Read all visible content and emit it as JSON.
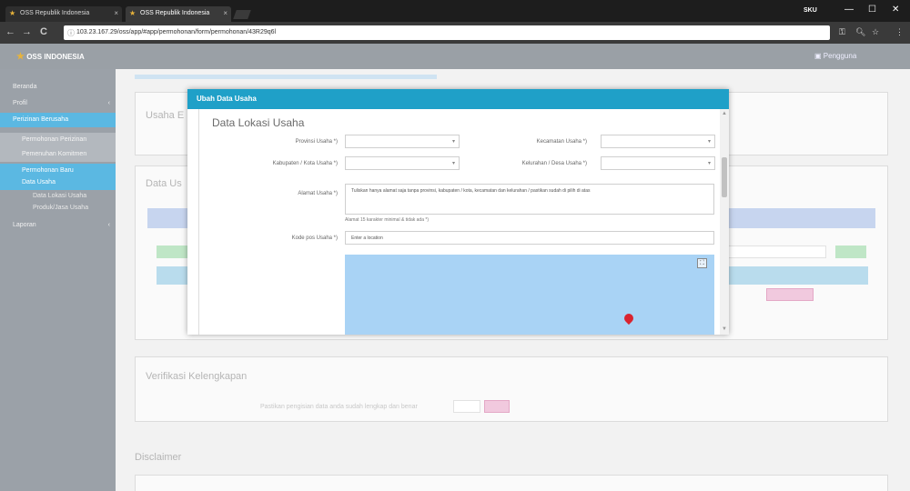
{
  "browser": {
    "tabs": [
      {
        "title": "OSS Republik Indonesia",
        "active": false
      },
      {
        "title": "OSS Republik Indonesia",
        "active": true
      }
    ],
    "profile": "SKU",
    "url": "103.23.167.29/oss/app/#app/permohonan/form/permohonan/43R29q6l",
    "nav": {
      "back": "←",
      "forward": "→",
      "reload": "C"
    },
    "window_controls": {
      "minimize": "—",
      "maximize": "☐",
      "close": "✕"
    }
  },
  "app": {
    "logo_text": "OSS INDONESIA",
    "user_label": "Pengguna"
  },
  "sidebar": {
    "items": [
      {
        "label": "Beranda",
        "state": "normal"
      },
      {
        "label": "Profil",
        "state": "normal"
      },
      {
        "label": "Perizinan Berusaha",
        "state": "active"
      },
      {
        "label": "Permohonan Perizinan",
        "state": "sub"
      },
      {
        "label": "Pemenuhan Komitmen",
        "state": "sub"
      },
      {
        "label": "Permohonan Baru",
        "state": "subactive"
      },
      {
        "label": "Data Usaha",
        "state": "subactive"
      },
      {
        "label": "Data Lokasi Usaha",
        "state": "sub2"
      },
      {
        "label": "Produk/Jasa Usaha",
        "state": "sub2"
      },
      {
        "label": "Laporan",
        "state": "normal"
      }
    ]
  },
  "background": {
    "panel1_title": "Usaha E",
    "panel2_title": "Data Us",
    "panel3_title": "Verifikasi Kelengkapan",
    "panel3_text": "Pastikan pengisian data anda sudah lengkap dan benar",
    "panel4_title": "Disclaimer"
  },
  "modal": {
    "title": "Ubah Data Usaha",
    "section_title": "Data Lokasi Usaha",
    "fields": {
      "provinsi_label": "Provinsi Usaha *)",
      "kecamatan_label": "Kecamatan Usaha *)",
      "kabupaten_label": "Kabupaten / Kota Usaha *)",
      "kelurahan_label": "Kelurahan / Desa Usaha *)",
      "alamat_label": "Alamat Usaha *)",
      "alamat_value": "Tuliskan hanya alamat saja tanpa provinsi, kabupaten / kota, kecamatan dan kelurahan / pastikan sudah di pilih di atas",
      "alamat_hint": "Alamat 15 karakter minimal & tidak ada *)",
      "kodepos_label": "Kode pos Usaha *)",
      "kodepos_placeholder": "Enter a location",
      "fullscreen_icon": "⛶"
    }
  }
}
